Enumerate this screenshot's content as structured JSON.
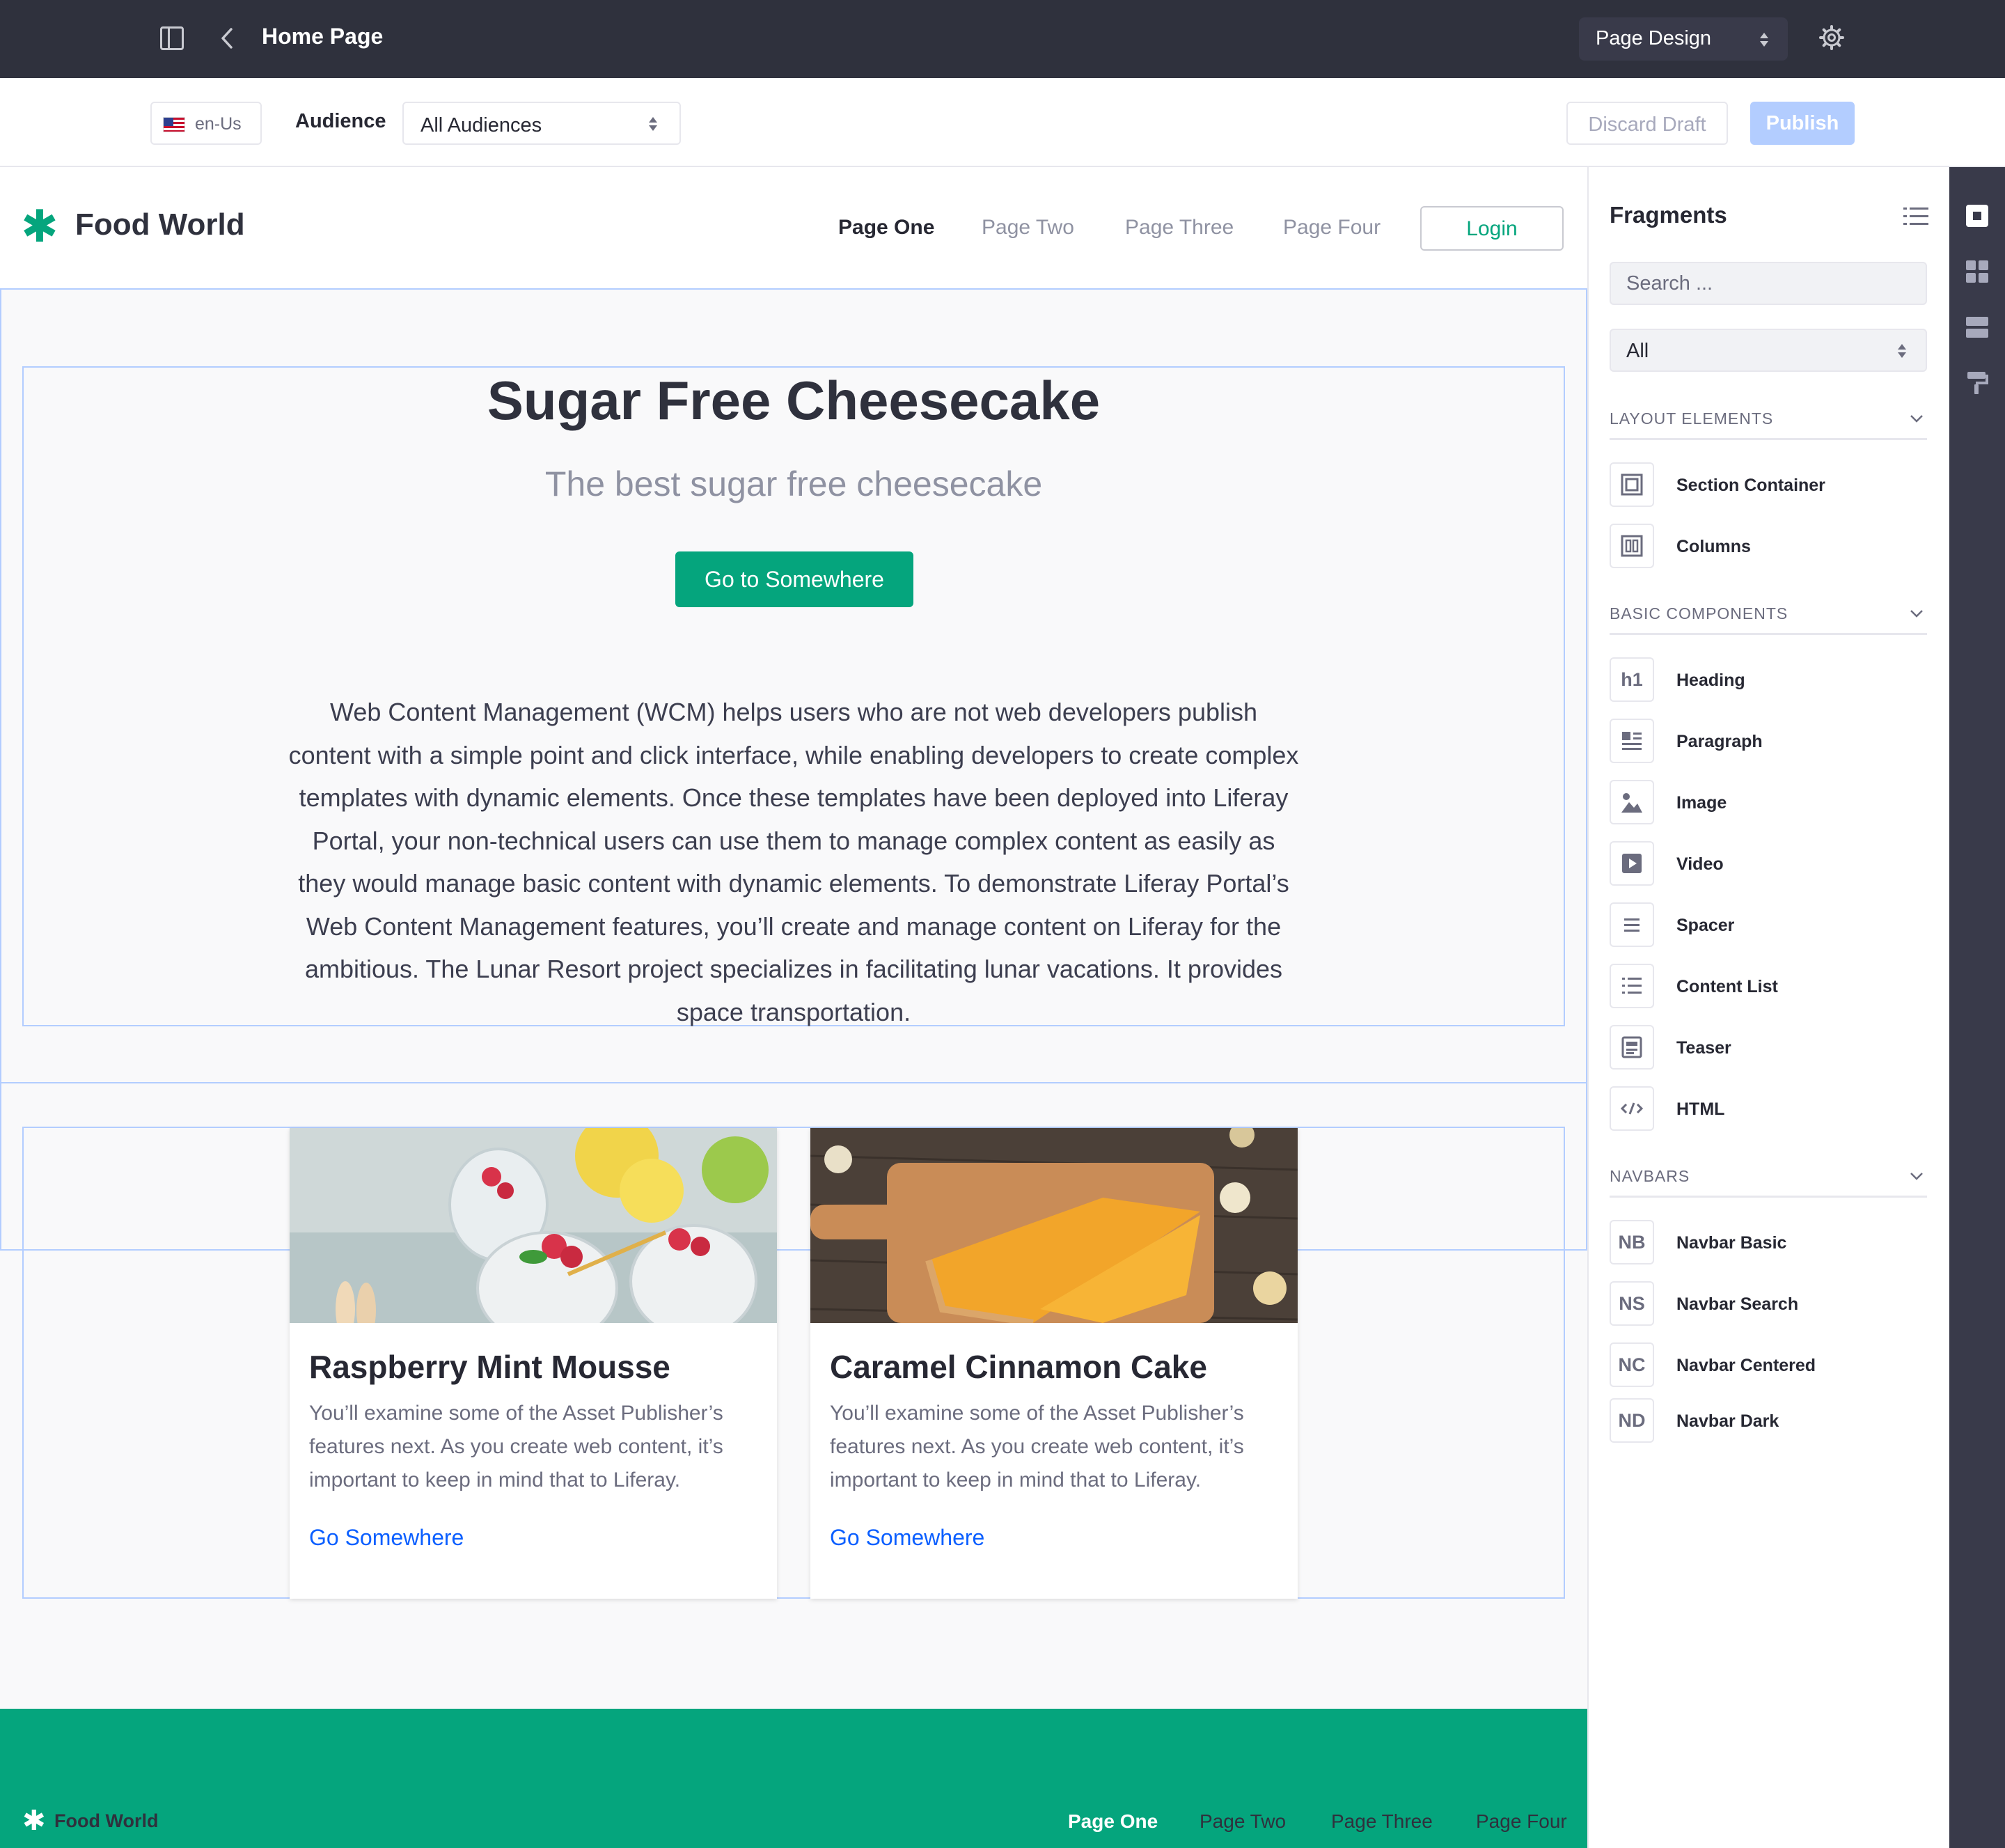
{
  "topbar": {
    "title": "Home Page",
    "mode_select": "Page Design"
  },
  "toolbar": {
    "language": "en-Us",
    "audience_label": "Audience",
    "audience_value": "All Audiences",
    "discard_label": "Discard Draft",
    "publish_label": "Publish"
  },
  "site": {
    "brand": "Food World",
    "nav": [
      "Page One",
      "Page Two",
      "Page Three",
      "Page Four"
    ],
    "login": "Login"
  },
  "hero": {
    "title": "Sugar Free Cheesecake",
    "subtitle": "The best sugar free cheesecake",
    "button": "Go to Somewhere",
    "body": "Web Content Management (WCM) helps users who are not web developers publish content with a simple point and click interface, while enabling developers to create complex templates with dynamic elements. Once these templates have been deployed into Liferay Portal, your non-technical users can use them to manage complex content as easily as they would manage basic content with dynamic elements. To demonstrate Liferay Portal’s Web Content Management features, you’ll create and manage content on Liferay for the ambitious. The Lunar Resort project specializes in facilitating lunar vacations. It provides space transportation."
  },
  "cards": [
    {
      "title": "Raspberry Mint Mousse",
      "text": "You’ll examine some of the Asset Publisher’s features next. As you create web content, it’s important to keep in mind that to Liferay.",
      "link": "Go Somewhere"
    },
    {
      "title": "Caramel Cinnamon Cake",
      "text": "You’ll examine some of the Asset Publisher’s features next. As you create web content, it’s important to keep in mind that to Liferay.",
      "link": "Go Somewhere"
    }
  ],
  "footer": {
    "brand": "Food World",
    "nav": [
      "Page One",
      "Page Two",
      "Page Three",
      "Page Four"
    ]
  },
  "panel": {
    "title": "Fragments",
    "search_placeholder": "Search ...",
    "filter_value": "All",
    "categories": {
      "layout": "LAYOUT ELEMENTS",
      "basic": "BASIC COMPONENTS",
      "navbars": "NAVBARS"
    },
    "layout_items": [
      "Section Container",
      "Columns"
    ],
    "basic_items": [
      "Heading",
      "Paragraph",
      "Image",
      "Video",
      "Spacer",
      "Content List",
      "Teaser",
      "HTML"
    ],
    "navbar_items": [
      {
        "abbr": "NB",
        "label": "Navbar Basic"
      },
      {
        "abbr": "NS",
        "label": "Navbar Search"
      },
      {
        "abbr": "NC",
        "label": "Navbar Centered"
      },
      {
        "abbr": "ND",
        "label": "Navbar Dark"
      }
    ],
    "heading_icon_text": "h1"
  },
  "colors": {
    "brand_green": "#05a57d",
    "topbar": "#2f313d",
    "primary_link": "#0b5fff",
    "publish_disabled": "#b3cdff",
    "outline": "#b3cdff"
  },
  "icons": {
    "topbar": [
      "sidebar-toggle-icon",
      "back-chevron-icon",
      "gear-icon"
    ],
    "rail": [
      "fragments-icon",
      "widgets-icon",
      "page-structure-icon",
      "look-and-feel-icon"
    ]
  }
}
